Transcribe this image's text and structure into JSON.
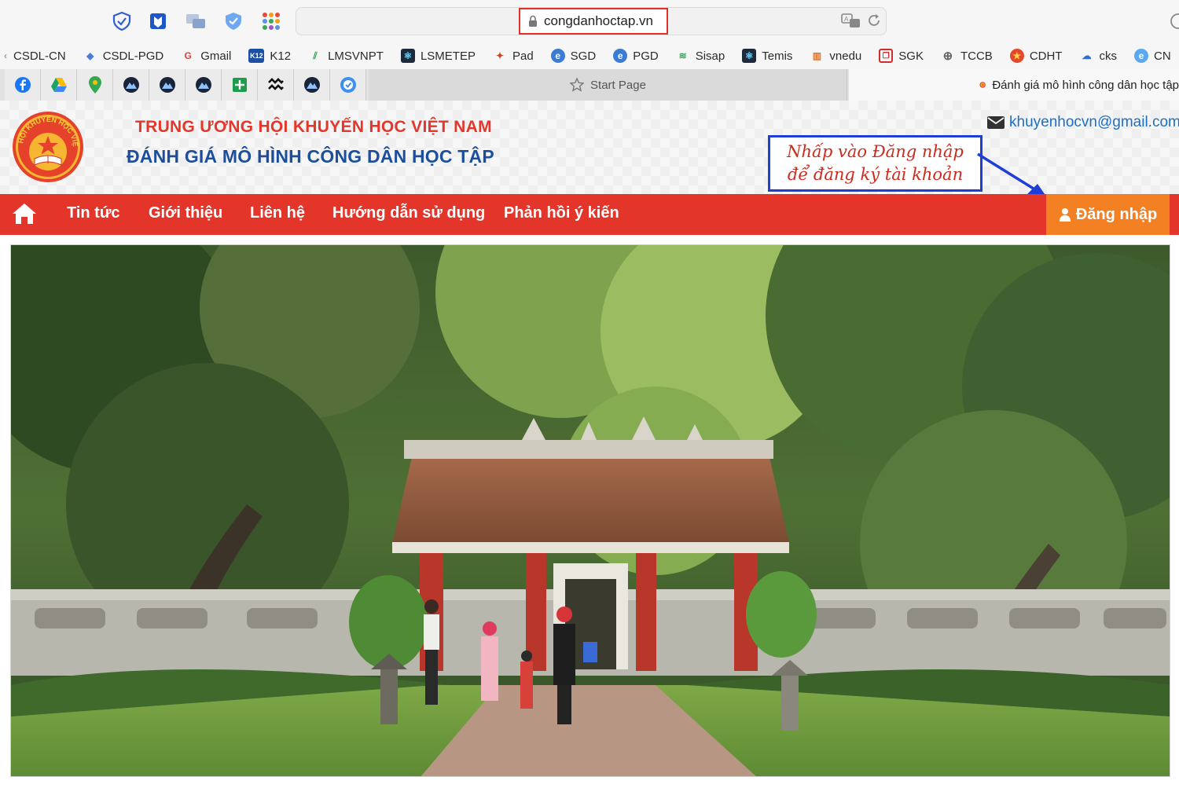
{
  "browser": {
    "url": "congdanhoctap.vn",
    "bookmarks": [
      {
        "label": "CSDL-CN",
        "icon": "chevron-icon"
      },
      {
        "label": "CSDL-PGD",
        "icon": "diamond-icon"
      },
      {
        "label": "Gmail",
        "icon": "google-icon"
      },
      {
        "label": "K12",
        "icon": "k12-icon"
      },
      {
        "label": "LMSVNPT",
        "icon": "lmsvnpt-icon"
      },
      {
        "label": "LSMETEP",
        "icon": "react-icon"
      },
      {
        "label": "Pad",
        "icon": "bird-icon"
      },
      {
        "label": "SGD",
        "icon": "edge-icon"
      },
      {
        "label": "PGD",
        "icon": "edge-icon"
      },
      {
        "label": "Sisap",
        "icon": "stack-icon"
      },
      {
        "label": "Temis",
        "icon": "react-icon"
      },
      {
        "label": "vnedu",
        "icon": "chart-icon"
      },
      {
        "label": "SGK",
        "icon": "book-icon"
      },
      {
        "label": "TCCB",
        "icon": "globe-icon"
      },
      {
        "label": "CDHT",
        "icon": "emblem-icon"
      },
      {
        "label": "cks",
        "icon": "cloud-icon"
      },
      {
        "label": "CN",
        "icon": "edge-icon"
      }
    ],
    "start_tab": "Start Page",
    "active_tab": "Đánh giá mô hình công dân học tập"
  },
  "header": {
    "org_line1": "TRUNG ƯƠNG HỘI KHUYẾN HỌC VIỆT NAM",
    "org_line2": "ĐÁNH GIÁ MÔ HÌNH CÔNG DÂN HỌC TẬP",
    "email": "khuyenhocvn@gmail.com",
    "logo_text": "HỘI KHUYẾN HỌC VIỆT NAM"
  },
  "callout": {
    "line1": "Nhấp vào Đăng nhập",
    "line2": "để đăng ký tài khoản"
  },
  "nav": {
    "items": [
      "Tin tức",
      "Giới thiệu",
      "Liên hệ",
      "Hướng dẫn sử dụng",
      "Phản hồi ý kiến"
    ],
    "login": "Đăng nhập"
  },
  "colors": {
    "nav_red": "#e4352a",
    "login_orange": "#f48024",
    "title_red": "#e4362a",
    "title_blue": "#1d4e9c",
    "callout_border": "#1f3ed6"
  }
}
